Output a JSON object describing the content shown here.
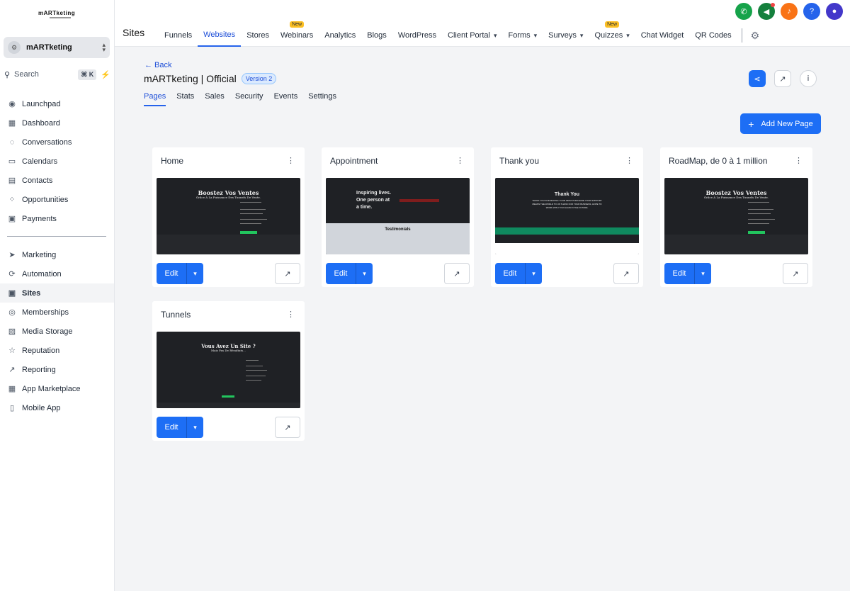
{
  "brand": {
    "logo_text": "mARTketing"
  },
  "account": {
    "name": "mARTketing"
  },
  "search": {
    "label": "Search",
    "shortcut": "⌘ K"
  },
  "sidebar": {
    "items_top": [
      {
        "label": "Launchpad",
        "icon": "rocket-icon"
      },
      {
        "label": "Dashboard",
        "icon": "grid-icon"
      },
      {
        "label": "Conversations",
        "icon": "chat-icon"
      },
      {
        "label": "Calendars",
        "icon": "calendar-icon"
      },
      {
        "label": "Contacts",
        "icon": "contacts-icon"
      },
      {
        "label": "Opportunities",
        "icon": "opportunities-icon"
      },
      {
        "label": "Payments",
        "icon": "payments-icon"
      }
    ],
    "items_bottom": [
      {
        "label": "Marketing",
        "icon": "send-icon"
      },
      {
        "label": "Automation",
        "icon": "automation-icon"
      },
      {
        "label": "Sites",
        "icon": "sites-icon",
        "active": true
      },
      {
        "label": "Memberships",
        "icon": "memberships-icon"
      },
      {
        "label": "Media Storage",
        "icon": "image-icon"
      },
      {
        "label": "Reputation",
        "icon": "star-icon"
      },
      {
        "label": "Reporting",
        "icon": "trend-icon"
      },
      {
        "label": "App Marketplace",
        "icon": "apps-icon"
      },
      {
        "label": "Mobile App",
        "icon": "mobile-icon"
      }
    ]
  },
  "topbar": {
    "title": "Sites",
    "tabs": [
      {
        "label": "Funnels"
      },
      {
        "label": "Websites",
        "active": true
      },
      {
        "label": "Stores"
      },
      {
        "label": "Webinars",
        "badge": "New"
      },
      {
        "label": "Analytics"
      },
      {
        "label": "Blogs"
      },
      {
        "label": "WordPress"
      },
      {
        "label": "Client Portal",
        "caret": true
      },
      {
        "label": "Forms",
        "caret": true
      },
      {
        "label": "Surveys",
        "caret": true
      },
      {
        "label": "Quizzes",
        "caret": true,
        "badge": "New"
      },
      {
        "label": "Chat Widget"
      },
      {
        "label": "QR Codes"
      }
    ],
    "icons": [
      {
        "name": "phone-icon",
        "color": "#16a34a"
      },
      {
        "name": "megaphone-icon",
        "color": "#15803d"
      },
      {
        "name": "bell-icon",
        "color": "#f97316"
      },
      {
        "name": "help-icon",
        "color": "#2563eb"
      },
      {
        "name": "avatar",
        "color": "#4338ca"
      }
    ]
  },
  "main": {
    "back_label": "← Back",
    "site_title": "mARTketing | Official",
    "version_label": "Version 2",
    "subtabs": [
      {
        "label": "Pages",
        "active": true
      },
      {
        "label": "Stats"
      },
      {
        "label": "Sales"
      },
      {
        "label": "Security"
      },
      {
        "label": "Events"
      },
      {
        "label": "Settings"
      }
    ],
    "add_page_label": "Add New Page"
  },
  "pages": [
    {
      "title": "Home",
      "thumb": "home"
    },
    {
      "title": "Appointment",
      "thumb": "appointment"
    },
    {
      "title": "Thank you",
      "thumb": "thankyou"
    },
    {
      "title": "RoadMap, de 0 à 1 million",
      "thumb": "home"
    },
    {
      "title": "Tunnels",
      "thumb": "tunnels"
    }
  ],
  "thumbs": {
    "home": {
      "headline": "Boostez Vos Ventes",
      "sub": "Grâce À La Puissance Des Tunnels De Vente."
    },
    "appointment": {
      "headline_1": "Inspiring lives.",
      "headline_2": "One person at",
      "headline_3": "a time.",
      "section": "Testimonials"
    },
    "thankyou": {
      "headline": "Thank You",
      "body": "THANK YOU FOR MAKING YOUR FIRST PURCHASE YOUR SUPPORT MEANS THE WORLD TO US THANK FOR YOUR BUSINESS, HOPE TO WORK WITH YOU AGAIN IN THE FUTURE."
    },
    "tunnels": {
      "headline": "Vous Avez Un Site ?",
      "sub": "Mais Pas De Résultats..."
    }
  },
  "card_buttons": {
    "edit_label": "Edit"
  }
}
